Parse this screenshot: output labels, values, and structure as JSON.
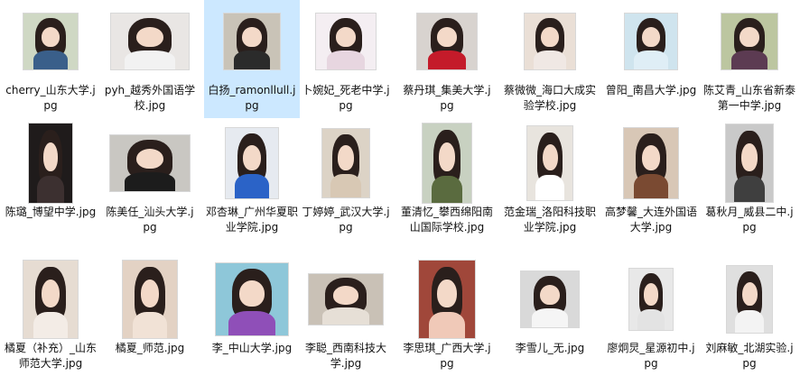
{
  "files": [
    {
      "label": "cherry_山东大学.jpg",
      "bg": "#cfd8c4",
      "top": "#3a5f8a"
    },
    {
      "label": "pyh_越秀外国语学校.jpg",
      "bg": "#e9e6e4",
      "top": "#f2f2f2"
    },
    {
      "label": "白扬_ramonllull.jpg",
      "bg": "#c9c3b7",
      "top": "#2b2b2b"
    },
    {
      "label": "卜婉妃_死老中学.jpg",
      "bg": "#f4eef2",
      "top": "#e7d6e0"
    },
    {
      "label": "蔡丹琪_集美大学.jpg",
      "bg": "#d8d3cf",
      "top": "#c41b2a"
    },
    {
      "label": "蔡微微_海口大成实验学校.jpg",
      "bg": "#eadfd6",
      "top": "#f0e8e4"
    },
    {
      "label": "曾阳_南昌大学.jpg",
      "bg": "#cfe4ee",
      "top": "#dfeef6"
    },
    {
      "label": "陈艾青_山东省新泰第一中学.jpg",
      "bg": "#bcc6a0",
      "top": "#5c3b52"
    },
    {
      "label": "陈璐_博望中学.jpg",
      "bg": "#1f1b1b",
      "top": "#3c3030"
    },
    {
      "label": "陈美任_汕头大学.jpg",
      "bg": "#c9c7c2",
      "top": "#1c1c1c"
    },
    {
      "label": "邓杏琳_广州华夏职业学院.jpg",
      "bg": "#e6eaf0",
      "top": "#2b63c7"
    },
    {
      "label": "丁婷婷_武汉大学.jpg",
      "bg": "#dcd3c6",
      "top": "#d8c8b4"
    },
    {
      "label": "董清忆_攀西绵阳南山国际学校.jpg",
      "bg": "#c8d1c1",
      "top": "#5a6b3f"
    },
    {
      "label": "范金瑞_洛阳科技职业学院.jpg",
      "bg": "#e8e4de",
      "top": "#ffffff"
    },
    {
      "label": "高梦馨_大连外国语大学.jpg",
      "bg": "#d8c7b6",
      "top": "#7a4a32"
    },
    {
      "label": "葛秋月_威县二中.jpg",
      "bg": "#c9c9c9",
      "top": "#3f3f3f"
    },
    {
      "label": "橘夏（补充）_山东师范大学.jpg",
      "bg": "#e6dcd2",
      "top": "#f3ece6"
    },
    {
      "label": "橘夏_师范.jpg",
      "bg": "#e3d2c4",
      "top": "#f1e2d6"
    },
    {
      "label": "李_中山大学.jpg",
      "bg": "#8ec7d9",
      "top": "#8f4fb8"
    },
    {
      "label": "李聪_西南科技大学.jpg",
      "bg": "#c9c1b6",
      "top": "#e6dfd6"
    },
    {
      "label": "李思琪_广西大学.jpg",
      "bg": "#a0473a",
      "top": "#f0c9b8"
    },
    {
      "label": "李雪儿_无.jpg",
      "bg": "#d9d9d9",
      "top": "#f5f5f5"
    },
    {
      "label": "廖炯炅_星源初中.jpg",
      "bg": "#e8e8e8",
      "top": "#e3e3e3"
    },
    {
      "label": "刘麻敏_北湖实验.jpg",
      "bg": "#dfdfdf",
      "top": "#f3f3f3"
    }
  ]
}
